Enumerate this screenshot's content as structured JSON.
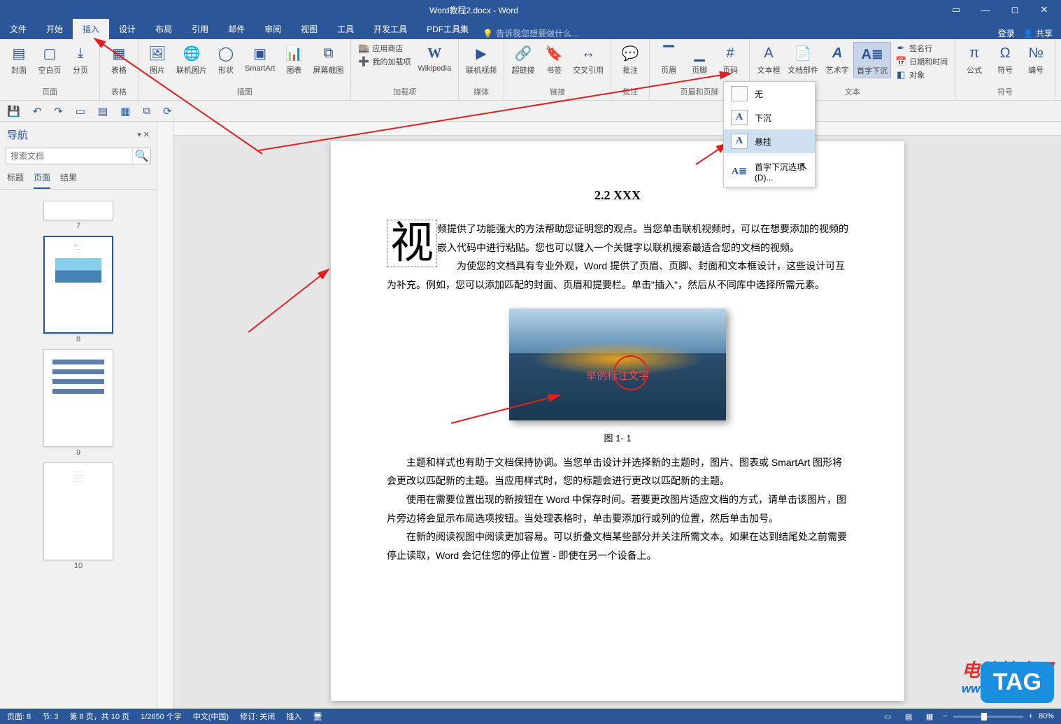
{
  "title_bar": {
    "title": "Word教程2.docx - Word"
  },
  "menu": {
    "tabs": [
      "文件",
      "开始",
      "插入",
      "设计",
      "布局",
      "引用",
      "邮件",
      "审阅",
      "视图",
      "工具",
      "开发工具",
      "PDF工具集"
    ],
    "active_index": 2,
    "tell_me": "告诉我您想要做什么...",
    "login": "登录",
    "share": "共享"
  },
  "ribbon": {
    "groups": [
      {
        "label": "页面",
        "items": [
          "封面",
          "空白页",
          "分页"
        ]
      },
      {
        "label": "表格",
        "items": [
          "表格"
        ]
      },
      {
        "label": "插图",
        "items": [
          "图片",
          "联机图片",
          "形状",
          "SmartArt",
          "图表",
          "屏幕截图"
        ]
      },
      {
        "label": "加载项",
        "items": [
          "应用商店",
          "我的加载项",
          "Wikipedia"
        ]
      },
      {
        "label": "媒体",
        "items": [
          "联机视频"
        ]
      },
      {
        "label": "链接",
        "items": [
          "超链接",
          "书签",
          "交叉引用"
        ]
      },
      {
        "label": "批注",
        "items": [
          "批注"
        ]
      },
      {
        "label": "页眉和页脚",
        "items": [
          "页眉",
          "页脚",
          "页码"
        ]
      },
      {
        "label": "文本",
        "items": [
          "文本框",
          "文档部件",
          "艺术字",
          "首字下沉"
        ],
        "side": [
          "签名行",
          "日期和时间",
          "对象"
        ]
      },
      {
        "label": "符号",
        "items": [
          "公式",
          "符号",
          "编号"
        ]
      }
    ]
  },
  "dropmenu": {
    "items": [
      "无",
      "下沉",
      "悬挂"
    ],
    "hover_index": 2,
    "options": "首字下沉选项(D)..."
  },
  "nav": {
    "title": "导航",
    "search_placeholder": "搜索文档",
    "tabs": [
      "标题",
      "页面",
      "结果"
    ],
    "active_tab": 1,
    "pages": [
      "7",
      "8",
      "9",
      "10"
    ],
    "selected": "8"
  },
  "doc": {
    "heading": "2.2 XXX",
    "dropcap": "视",
    "para1": "频提供了功能强大的方法帮助您证明您的观点。当您单击联机视频时，可以在想要添加的视频的嵌入代码中进行粘贴。您也可以键入一个关键字以联机搜索最适合您的文档的视频。",
    "para2": "为使您的文档具有专业外观，Word 提供了页眉、页脚、封面和文本框设计，这些设计可互为补充。例如，您可以添加匹配的封面、页眉和提要栏。单击\"插入\"，然后从不同库中选择所需元素。",
    "fig_overlay": "举例标注文字",
    "fig_caption": "图 1- 1",
    "para3": "主题和样式也有助于文档保持协调。当您单击设计并选择新的主题时，图片、图表或 SmartArt 图形将会更改以匹配新的主题。当应用样式时，您的标题会进行更改以匹配新的主题。",
    "para4": "使用在需要位置出现的新按钮在 Word 中保存时间。若要更改图片适应文档的方式，请单击该图片，图片旁边将会显示布局选项按钮。当处理表格时，单击要添加行或列的位置，然后单击加号。",
    "para5": "在新的阅读视图中阅读更加容易。可以折叠文档某些部分并关注所需文本。如果在达到结尾处之前需要停止读取，Word 会记住您的停止位置 - 即使在另一个设备上。"
  },
  "status": {
    "page": "页面: 8",
    "section": "节: 3",
    "page_of": "第 8 页，共 10 页",
    "words": "1/2650 个字",
    "lang": "中文(中国)",
    "track": "修订: 关闭",
    "mode": "插入",
    "zoom": "80%"
  },
  "watermark": {
    "line1": "电脑技术网",
    "line2": "www.tagxp.com",
    "tag": "TAG"
  }
}
